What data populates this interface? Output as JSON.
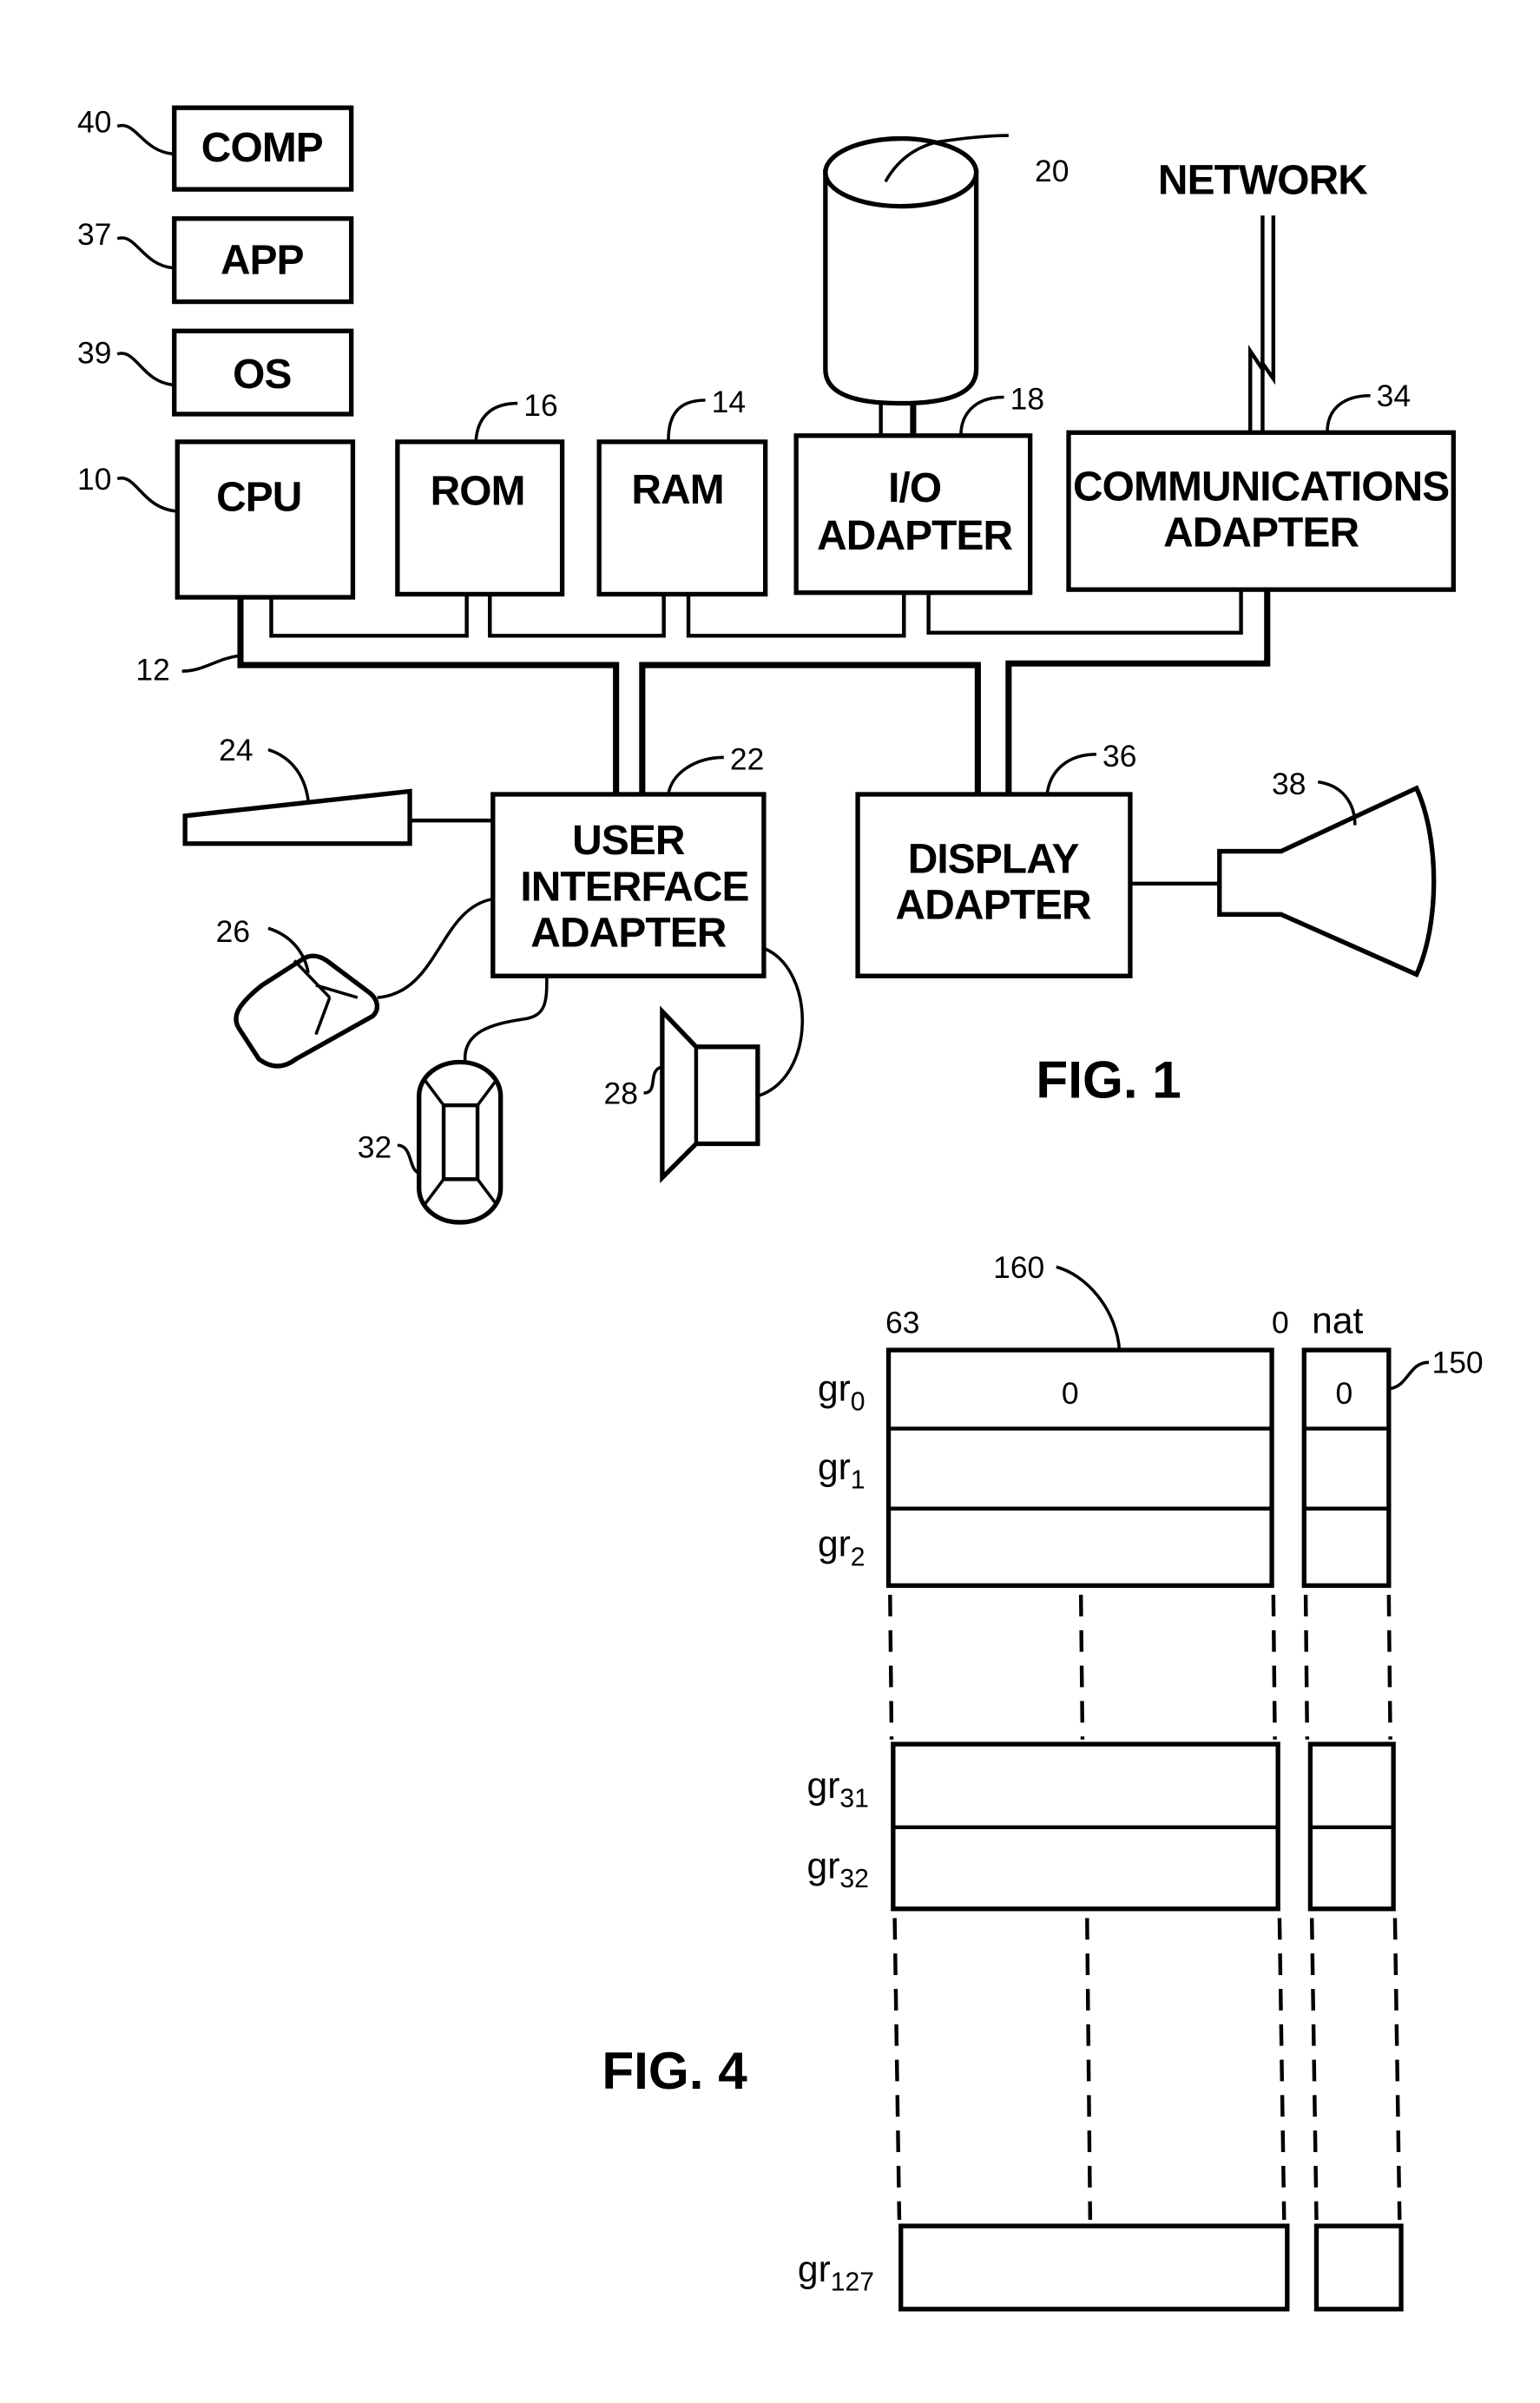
{
  "fig1": {
    "caption": "FIG. 1",
    "software_stack": [
      {
        "ref": "40",
        "label": "COMP"
      },
      {
        "ref": "37",
        "label": "APP"
      },
      {
        "ref": "39",
        "label": "OS"
      }
    ],
    "cpu": {
      "ref": "10",
      "label": "CPU"
    },
    "rom": {
      "ref": "16",
      "label": "ROM"
    },
    "ram": {
      "ref": "14",
      "label": "RAM"
    },
    "io_adapter": {
      "ref": "18",
      "label_line1": "I/O",
      "label_line2": "ADAPTER"
    },
    "comm_adapter": {
      "ref": "34",
      "label_line1": "COMMUNICATIONS",
      "label_line2": "ADAPTER"
    },
    "disk": {
      "ref": "20"
    },
    "network": {
      "label": "NETWORK"
    },
    "bus": {
      "ref": "12"
    },
    "ui_adapter": {
      "ref": "22",
      "label_line1": "USER",
      "label_line2": "INTERFACE",
      "label_line3": "ADAPTER"
    },
    "display_adapter": {
      "ref": "36",
      "label_line1": "DISPLAY",
      "label_line2": "ADAPTER"
    },
    "keyboard": {
      "ref": "24"
    },
    "mouse": {
      "ref": "26"
    },
    "joystick": {
      "ref": "32"
    },
    "speaker": {
      "ref": "28"
    },
    "monitor": {
      "ref": "38"
    }
  },
  "fig4": {
    "caption": "FIG. 4",
    "register_file_ref": "160",
    "nat_ref": "150",
    "bit_high": "63",
    "bit_low": "0",
    "nat_header": "nat",
    "registers": [
      {
        "base": "gr",
        "index": "0",
        "value": "0",
        "nat_value": "0"
      },
      {
        "base": "gr",
        "index": "1",
        "value": "",
        "nat_value": ""
      },
      {
        "base": "gr",
        "index": "2",
        "value": "",
        "nat_value": ""
      },
      {
        "base": "gr",
        "index": "31",
        "value": "",
        "nat_value": ""
      },
      {
        "base": "gr",
        "index": "32",
        "value": "",
        "nat_value": ""
      },
      {
        "base": "gr",
        "index": "127",
        "value": "",
        "nat_value": ""
      }
    ]
  }
}
